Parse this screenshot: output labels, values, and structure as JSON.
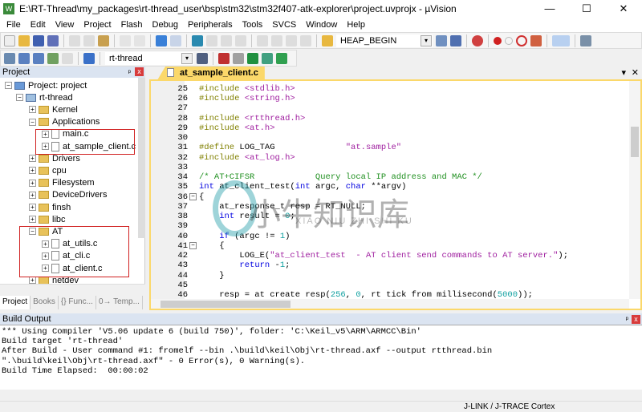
{
  "window": {
    "title": "E:\\RT-Thread\\my_packages\\rt-thread_user\\bsp\\stm32\\stm32f407-atk-explorer\\project.uvprojx - µVision",
    "icon": "W",
    "minimize": "—",
    "maximize": "☐",
    "close": "✕"
  },
  "menu": [
    "File",
    "Edit",
    "View",
    "Project",
    "Flash",
    "Debug",
    "Peripherals",
    "Tools",
    "SVCS",
    "Window",
    "Help"
  ],
  "toolbar1": {
    "find_combo": "HEAP_BEGIN"
  },
  "toolbar2": {
    "target_combo": "rt-thread"
  },
  "project_panel": {
    "title": "Project",
    "pin": "ᵖ",
    "close": "x",
    "tree": [
      {
        "label": "Project: project",
        "level": 0,
        "type": "root",
        "exp": "−"
      },
      {
        "label": "rt-thread",
        "level": 1,
        "type": "root",
        "exp": "−"
      },
      {
        "label": "Kernel",
        "level": 2,
        "type": "folder",
        "exp": "+"
      },
      {
        "label": "Applications",
        "level": 2,
        "type": "folder",
        "exp": "−"
      },
      {
        "label": "main.c",
        "level": 3,
        "type": "file",
        "exp": "+"
      },
      {
        "label": "at_sample_client.c",
        "level": 3,
        "type": "file",
        "exp": "+"
      },
      {
        "label": "Drivers",
        "level": 2,
        "type": "folder",
        "exp": "+"
      },
      {
        "label": "cpu",
        "level": 2,
        "type": "folder",
        "exp": "+"
      },
      {
        "label": "Filesystem",
        "level": 2,
        "type": "folder",
        "exp": "+"
      },
      {
        "label": "DeviceDrivers",
        "level": 2,
        "type": "folder",
        "exp": "+"
      },
      {
        "label": "finsh",
        "level": 2,
        "type": "folder",
        "exp": "+"
      },
      {
        "label": "libc",
        "level": 2,
        "type": "folder",
        "exp": "+"
      },
      {
        "label": "AT",
        "level": 2,
        "type": "folder",
        "exp": "−"
      },
      {
        "label": "at_utils.c",
        "level": 3,
        "type": "file",
        "exp": "+"
      },
      {
        "label": "at_cli.c",
        "level": 3,
        "type": "file",
        "exp": "+"
      },
      {
        "label": "at_client.c",
        "level": 3,
        "type": "file",
        "exp": "+"
      },
      {
        "label": "netdev",
        "level": 2,
        "type": "folder",
        "exp": "+"
      }
    ],
    "tabs": [
      "Project",
      "Books",
      "{} Func...",
      "0→ Temp..."
    ]
  },
  "editor": {
    "tab": "at_sample_client.c",
    "menu": "▾",
    "close": "✕",
    "lines": [
      {
        "n": "25",
        "t": [
          [
            "#include ",
            "pp"
          ],
          [
            "<stdlib.h>",
            "inc"
          ]
        ]
      },
      {
        "n": "26",
        "t": [
          [
            "#include ",
            "pp"
          ],
          [
            "<string.h>",
            "inc"
          ]
        ]
      },
      {
        "n": "27",
        "t": []
      },
      {
        "n": "28",
        "t": [
          [
            "#include ",
            "pp"
          ],
          [
            "<rtthread.h>",
            "inc"
          ]
        ]
      },
      {
        "n": "29",
        "t": [
          [
            "#include ",
            "pp"
          ],
          [
            "<at.h>",
            "inc"
          ]
        ]
      },
      {
        "n": "30",
        "t": []
      },
      {
        "n": "31",
        "t": [
          [
            "#define ",
            "pp"
          ],
          [
            "LOG_TAG              ",
            ""
          ],
          [
            "\"at.sample\"",
            "st"
          ]
        ]
      },
      {
        "n": "32",
        "t": [
          [
            "#include ",
            "pp"
          ],
          [
            "<at_log.h>",
            "inc"
          ]
        ]
      },
      {
        "n": "33",
        "t": []
      },
      {
        "n": "34",
        "t": [
          [
            "/* AT+CIFSR            Query local IP address and MAC */",
            "cm"
          ]
        ]
      },
      {
        "n": "35",
        "t": [
          [
            "int",
            "kw"
          ],
          [
            " at_client_test(",
            ""
          ],
          [
            "int",
            "kw"
          ],
          [
            " argc, ",
            ""
          ],
          [
            "char",
            "kw"
          ],
          [
            " **argv)",
            ""
          ]
        ]
      },
      {
        "n": "36",
        "t": [
          [
            "{",
            ""
          ]
        ],
        "fold": "−"
      },
      {
        "n": "37",
        "t": [
          [
            "    at_response_t resp = RT_NULL;",
            ""
          ]
        ]
      },
      {
        "n": "38",
        "t": [
          [
            "    ",
            ""
          ],
          [
            "int",
            "kw"
          ],
          [
            " result = ",
            ""
          ],
          [
            "0",
            "nm"
          ],
          [
            ";",
            ""
          ]
        ]
      },
      {
        "n": "39",
        "t": []
      },
      {
        "n": "40",
        "t": [
          [
            "    ",
            ""
          ],
          [
            "if",
            "kw"
          ],
          [
            " (argc != ",
            ""
          ],
          [
            "1",
            "nm"
          ],
          [
            ")",
            ""
          ]
        ]
      },
      {
        "n": "41",
        "t": [
          [
            "    {",
            ""
          ]
        ],
        "fold": "−"
      },
      {
        "n": "42",
        "t": [
          [
            "        LOG_E(",
            ""
          ],
          [
            "\"at_client_test  - AT client send commands to AT server.\"",
            "st"
          ],
          [
            ");",
            ""
          ]
        ]
      },
      {
        "n": "43",
        "t": [
          [
            "        ",
            ""
          ],
          [
            "return",
            "kw"
          ],
          [
            " -",
            ""
          ],
          [
            "1",
            "nm"
          ],
          [
            ";",
            ""
          ]
        ]
      },
      {
        "n": "44",
        "t": [
          [
            "    }",
            ""
          ]
        ]
      },
      {
        "n": "45",
        "t": []
      },
      {
        "n": "46",
        "t": [
          [
            "    resp = at create resp(",
            ""
          ],
          [
            "256",
            "nm"
          ],
          [
            ", ",
            ""
          ],
          [
            "0",
            "nm"
          ],
          [
            ", rt tick from millisecond(",
            ""
          ],
          [
            "5000",
            "nm"
          ],
          [
            "));",
            ""
          ]
        ]
      }
    ]
  },
  "watermark": {
    "text": "小牛知识库",
    "sub": "XIAO NIU ZHI SHI KU"
  },
  "build_output": {
    "title": "Build Output",
    "pin": "ᵖ",
    "close": "x",
    "lines": [
      "*** Using Compiler 'V5.06 update 6 (build 750)', folder: 'C:\\Keil_v5\\ARM\\ARMCC\\Bin'",
      "Build target 'rt-thread'",
      "After Build - User command #1: fromelf --bin .\\build\\keil\\Obj\\rt-thread.axf --output rtthread.bin",
      "\".\\build\\keil\\Obj\\rt-thread.axf\" - 0 Error(s), 0 Warning(s).",
      "Build Time Elapsed:  00:00:02"
    ]
  },
  "status": {
    "debugger": "J-LINK / J-TRACE Cortex"
  },
  "colors": {
    "accent_tab": "#fbd86a",
    "panel_header": "#dbe4f1",
    "highlight_box": "#d02020",
    "keyword": "#0000e0",
    "comment": "#209020",
    "string": "#a020a0"
  }
}
